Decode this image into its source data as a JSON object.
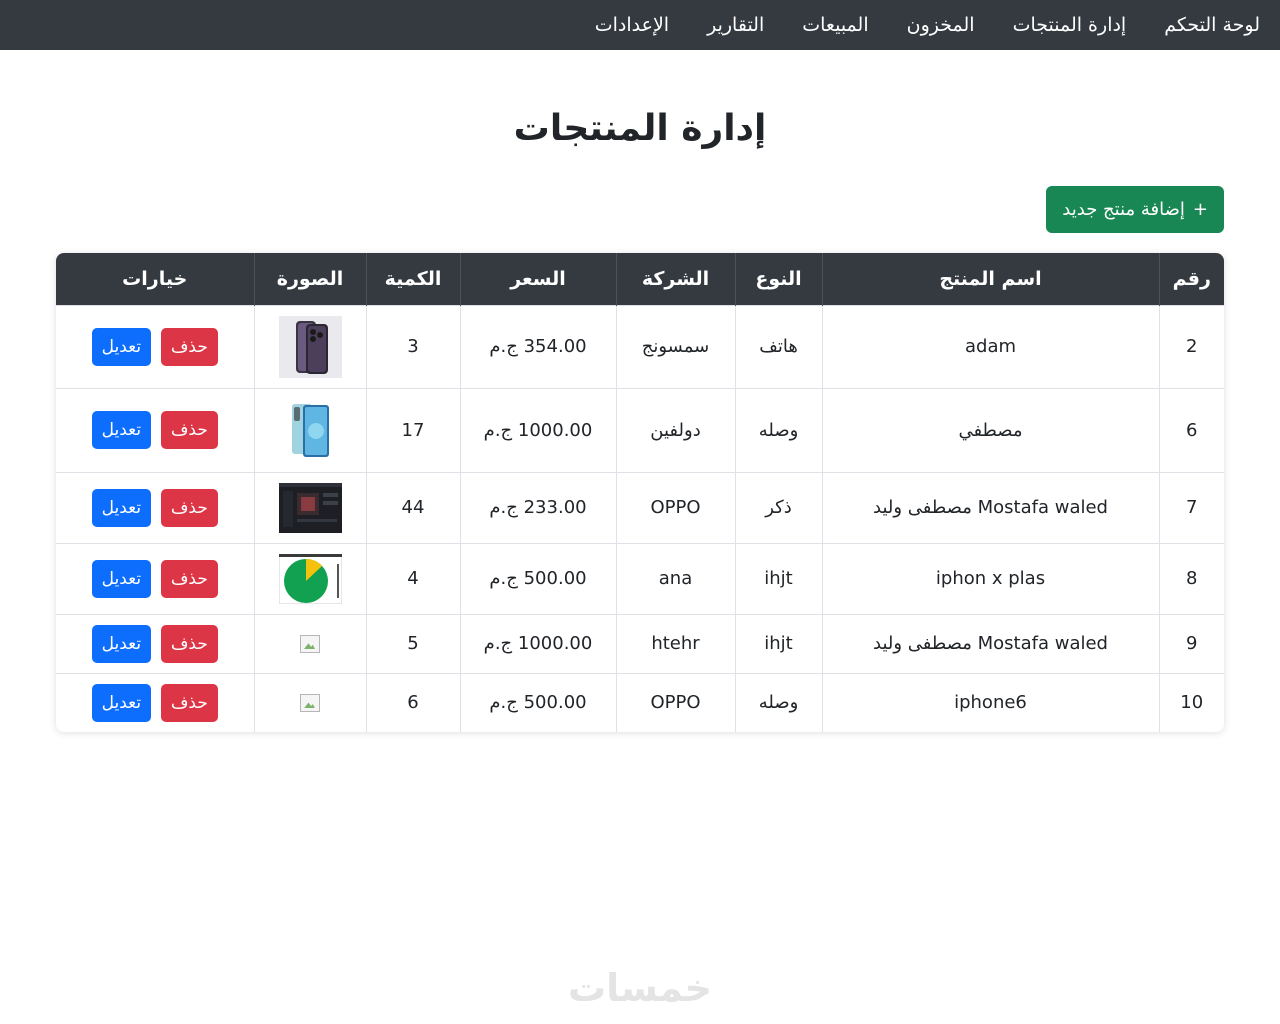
{
  "nav": {
    "items": [
      "لوحة التحكم",
      "إدارة المنتجات",
      "المخزون",
      "المبيعات",
      "التقارير",
      "الإعدادات"
    ]
  },
  "page": {
    "title": "إدارة المنتجات",
    "add_button": {
      "icon": "+",
      "label": "إضافة منتج جديد"
    }
  },
  "table": {
    "headers": [
      "رقم",
      "اسم المنتج",
      "النوع",
      "الشركة",
      "السعر",
      "الكمية",
      "الصورة",
      "خيارات"
    ],
    "rows": [
      {
        "id": "2",
        "name": "adam",
        "type": "هاتف",
        "company": "سمسونج",
        "price": "354.00 ج.م",
        "qty": "3",
        "image": "iphone-purple",
        "delete": "حذف",
        "edit": "تعديل"
      },
      {
        "id": "6",
        "name": "مصطفي",
        "type": "وصله",
        "company": "دولفين",
        "price": "1000.00 ج.م",
        "qty": "17",
        "image": "oppo-phone-blue",
        "delete": "حذف",
        "edit": "تعديل"
      },
      {
        "id": "7",
        "name": "Mostafa waled مصطفى وليد",
        "type": "ذكر",
        "company": "OPPO",
        "price": "233.00 ج.م",
        "qty": "44",
        "image": "dark-screenshot",
        "delete": "حذف",
        "edit": "تعديل"
      },
      {
        "id": "8",
        "name": "iphon x plas",
        "type": "ihjt",
        "company": "ana",
        "price": "500.00 ج.م",
        "qty": "4",
        "image": "pie-chart-green",
        "delete": "حذف",
        "edit": "تعديل"
      },
      {
        "id": "9",
        "name": "Mostafa waled مصطفى وليد",
        "type": "ihjt",
        "company": "htehr",
        "price": "1000.00 ج.م",
        "qty": "5",
        "image": "broken-image",
        "delete": "حذف",
        "edit": "تعديل"
      },
      {
        "id": "10",
        "name": "iphone6",
        "type": "وصله",
        "company": "OPPO",
        "price": "500.00 ج.م",
        "qty": "6",
        "image": "broken-image",
        "delete": "حذف",
        "edit": "تعديل"
      }
    ]
  },
  "watermark": {
    "text": "خمسات"
  },
  "colors": {
    "navbar": "#343a40",
    "success": "#198754",
    "danger": "#dc3545",
    "primary": "#0d6efd"
  }
}
